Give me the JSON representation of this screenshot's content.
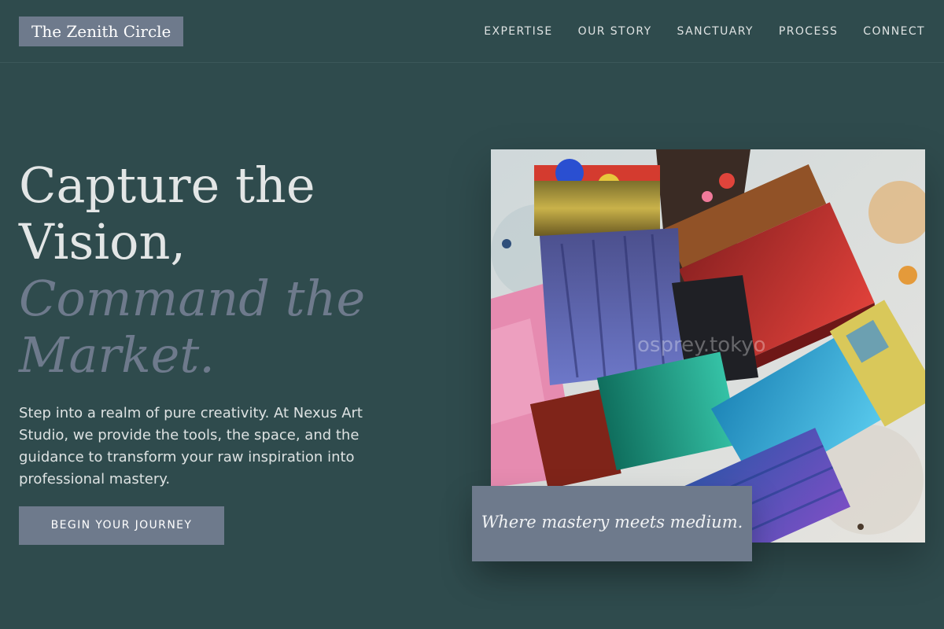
{
  "brand": {
    "logo": "The Zenith Circle"
  },
  "nav": {
    "items": [
      "EXPERTISE",
      "OUR STORY",
      "SANCTUARY",
      "PROCESS",
      "CONNECT"
    ]
  },
  "hero": {
    "headline": [
      "Capture the",
      "Vision,",
      "Command the",
      "Market."
    ],
    "lead": "Step into a realm of pure creativity. At Nexus Art Studio, we provide the tools, the space, and the guidance to transform your raw inspiration into professional mastery.",
    "cta": "BEGIN YOUR JOURNEY"
  },
  "image": {
    "watermark": "osprey.tokyo",
    "caption": "Where mastery meets medium."
  },
  "colors": {
    "background": "#2f4b4d",
    "accent": "#6e7a8c",
    "text": "#e3e6e6"
  }
}
